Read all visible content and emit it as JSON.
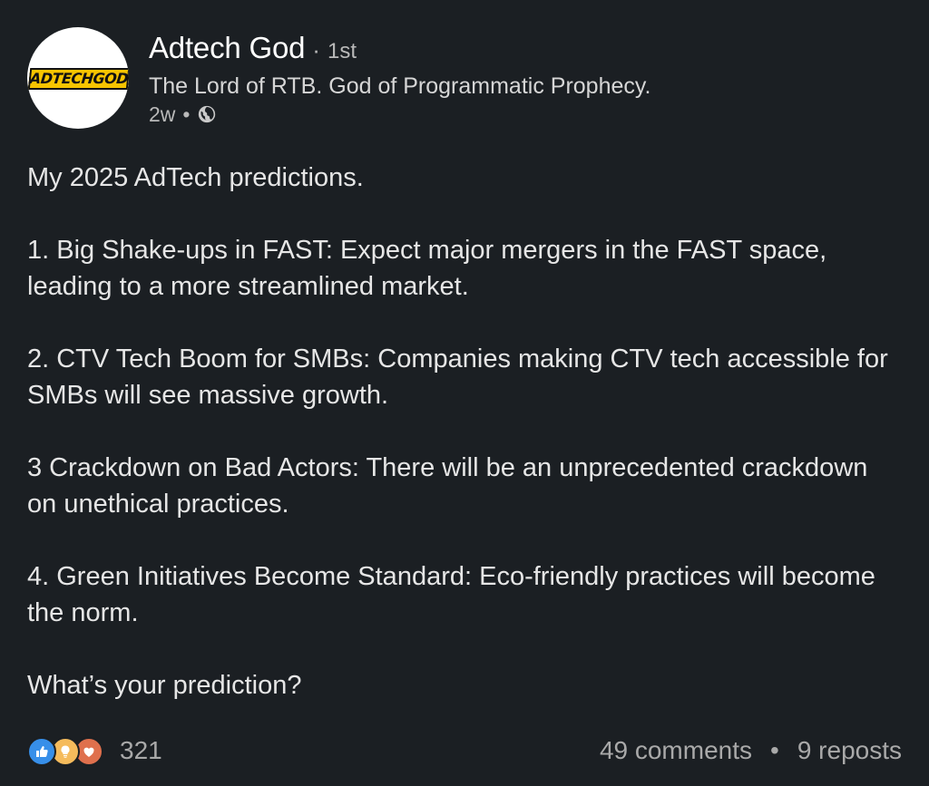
{
  "author": {
    "avatar_text": "ADTECHGOD",
    "name": "Adtech God",
    "degree": "1st",
    "headline": "The Lord of RTB. God of Programmatic Prophecy.",
    "time": "2w",
    "visibility_icon": "globe-icon"
  },
  "post": {
    "intro": "My 2025 AdTech predictions.",
    "p1": "1. Big Shake-ups in FAST: Expect major mergers in the FAST space, leading to a more streamlined market.",
    "p2": "2. CTV Tech Boom for SMBs: Companies making CTV tech accessible for SMBs will see massive growth.",
    "p3": "3 Crackdown on Bad Actors: There will be an unprecedented crackdown on unethical practices.",
    "p4": "4. Green Initiatives Become Standard: Eco-friendly practices will become the norm.",
    "question": "What’s your prediction?"
  },
  "social": {
    "reaction_icons": [
      "like-icon",
      "insightful-icon",
      "love-icon"
    ],
    "reaction_count": "321",
    "comments": "49 comments",
    "separator": "•",
    "reposts": "9 reposts"
  },
  "colors": {
    "background": "#1b1f23",
    "text": "#e6e6e6",
    "muted": "#a9a9a9",
    "like": "#378fe9",
    "insightful": "#f5bb5c",
    "love": "#df704d",
    "logo_yellow": "#f7c400"
  }
}
